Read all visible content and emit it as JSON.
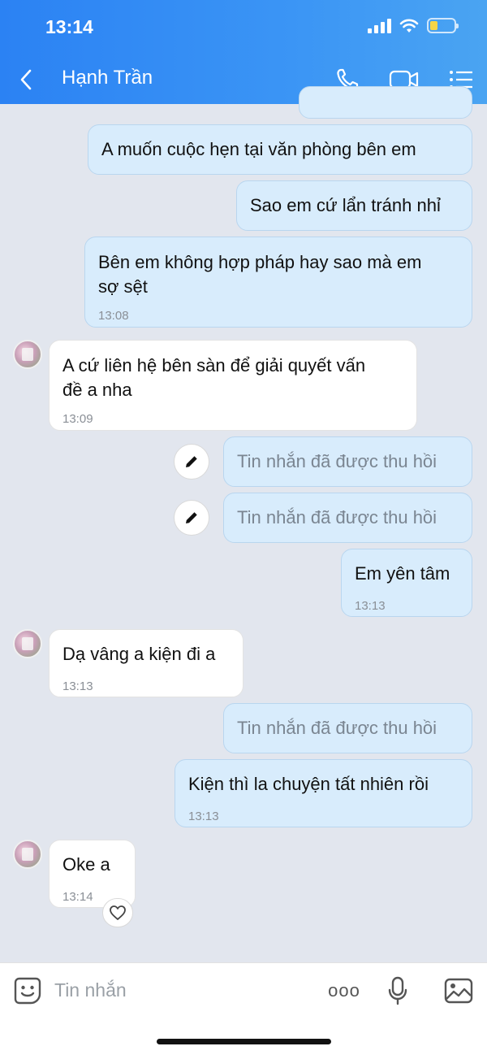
{
  "status_bar": {
    "time": "13:14"
  },
  "header": {
    "contact_name": "Hạnh Trần"
  },
  "messages": [
    {
      "text": "A muốn cuộc hẹn tại văn phòng bên em"
    },
    {
      "text": "Sao em cứ lẩn tránh nhỉ"
    },
    {
      "text_line1": "Bên em không hợp pháp hay sao mà em",
      "text_line2": "sợ sệt",
      "time": "13:08"
    },
    {
      "text_line1": "A cứ liên hệ bên sàn để giải quyết vấn",
      "text_line2": "đề a nha",
      "time": "13:09"
    },
    {
      "text": "Tin nhắn đã được thu hồi"
    },
    {
      "text": "Tin nhắn đã được thu hồi"
    },
    {
      "text": "Em yên tâm",
      "time": "13:13"
    },
    {
      "text": "Dạ vâng a kiện đi a",
      "time": "13:13"
    },
    {
      "text": "Tin nhắn đã được thu hồi"
    },
    {
      "text": "Kiện thì la chuyện tất nhiên rồi",
      "time": "13:13"
    },
    {
      "text": "Oke a",
      "time": "13:14"
    }
  ],
  "input": {
    "placeholder": "Tin nhắn",
    "more_label": "ooo"
  },
  "icons": {
    "back": "chevron-left-icon",
    "call": "phone-icon",
    "video": "video-camera-icon",
    "menu": "list-menu-icon",
    "edit": "pencil-icon",
    "react": "heart-icon",
    "sticker": "sticker-icon",
    "mic": "microphone-icon",
    "image": "image-icon"
  },
  "colors": {
    "header_start": "#2b82f3",
    "outgoing_bubble": "#d8ecfc",
    "incoming_bubble": "#ffffff",
    "background": "#e2e6ee"
  }
}
